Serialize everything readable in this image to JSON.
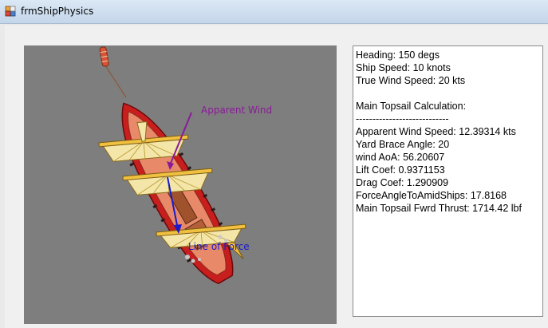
{
  "window": {
    "title": "frmShipPhysics"
  },
  "canvas": {
    "background_color": "#7e7e7e",
    "apparent_wind_label": "Apparent Wind",
    "line_of_force_label": "Line of Force",
    "apparent_wind_color": "#8a1a99",
    "line_of_force_color": "#1a1acc"
  },
  "info": {
    "lines": [
      "Heading: 150 degs",
      "Ship Speed: 10 knots",
      "True Wind Speed: 20 kts",
      "",
      "Main Topsail Calculation:",
      "----------------------------",
      "Apparent Wind Speed: 12.39314 kts",
      "Yard Brace Angle: 20",
      "wind AoA: 56.20607",
      "Lift Coef: 0.9371153",
      "Drag Coef: 1.290909",
      "ForceAngleToAmidShips: 17.8168",
      "Main Topsail Fwrd Thrust: 1714.42 lbf"
    ]
  }
}
